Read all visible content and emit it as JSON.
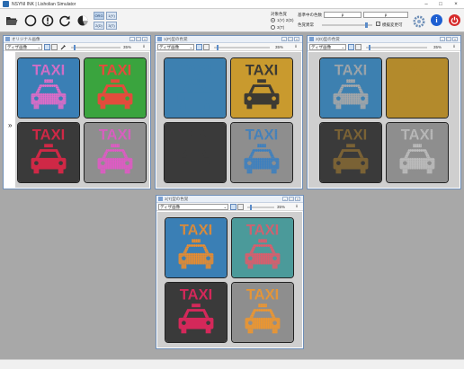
{
  "app": {
    "title": "NSYNI INK | Lisholian Simulator"
  },
  "toolbar": {
    "modes": [
      "ORG",
      "1(Y)",
      "2(D)",
      "3(T)"
    ],
    "target_label": "対象色覚",
    "radio_1": "1(Y) 2(D)",
    "radio_2": "3(T)",
    "mag_label": "基準中の色数",
    "level_label": "色覚異常",
    "field_left": "p",
    "field_right": "p",
    "checkbox_label": "模擬変更可"
  },
  "tile_text": "TAXI",
  "windows": [
    {
      "title": "オリジナル画像",
      "select": "ディザ画像",
      "pct": "35%"
    },
    {
      "title": "1(P)型の色覚",
      "select": "ディザ画像",
      "pct": "35%"
    },
    {
      "title": "2(D)型の色覚",
      "select": "ディザ画像",
      "pct": "35%"
    },
    {
      "title": "3(T)型の色覚",
      "select": "ディザ画像",
      "pct": "35%"
    }
  ],
  "colors": {
    "w0": [
      {
        "bg": "#3a7fb5",
        "fg": "#e56bc8",
        "dot": true
      },
      {
        "bg": "#3aa43e",
        "fg": "#e24c3c",
        "dot": false
      },
      {
        "bg": "#3a3a3a",
        "fg": "#cf2846",
        "dot": false
      },
      {
        "bg": "#8e8e8e",
        "fg": "#e258c6",
        "dot": true
      }
    ],
    "w1": [
      {
        "bg": "#3d80b0",
        "fg": "#3d80b0",
        "dot": true
      },
      {
        "bg": "#c99a2e",
        "fg": "#3d3a33",
        "dot": false
      },
      {
        "bg": "#3a3a3a",
        "fg": "#3a3a3a",
        "dot": true
      },
      {
        "bg": "#8e8e8e",
        "fg": "#3a7fc0",
        "dot": true
      }
    ],
    "w2": [
      {
        "bg": "#3d80b0",
        "fg": "#a8a8a8",
        "dot": true
      },
      {
        "bg": "#b38a2c",
        "fg": "#b38a2c",
        "dot": false
      },
      {
        "bg": "#3a3a3a",
        "fg": "#7a6235",
        "dot": false
      },
      {
        "bg": "#8e8e8e",
        "fg": "#bdbdbd",
        "dot": true
      }
    ],
    "w3": [
      {
        "bg": "#3a7fb5",
        "fg": "#ec8c2c",
        "dot": true
      },
      {
        "bg": "#4b9a9a",
        "fg": "#e05a6a",
        "dot": true
      },
      {
        "bg": "#3a3a3a",
        "fg": "#d4285a",
        "dot": false
      },
      {
        "bg": "#8e8e8e",
        "fg": "#f0962c",
        "dot": true
      }
    ]
  }
}
